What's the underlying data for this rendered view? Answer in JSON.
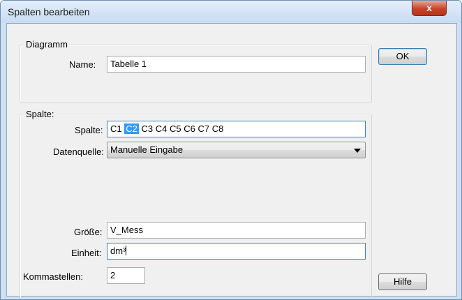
{
  "window": {
    "title": "Spalten bearbeiten",
    "close_label": "x"
  },
  "diagramm": {
    "legend": "Diagramm",
    "name_label": "Name:",
    "name_value": "Tabelle 1"
  },
  "spalte": {
    "legend": "Spalte:",
    "spalte_label": "Spalte:",
    "columns": [
      "C1",
      "C2",
      "C3",
      "C4",
      "C5",
      "C6",
      "C7",
      "C8"
    ],
    "selected_column": "C2",
    "datenquelle_label": "Datenquelle:",
    "datenquelle_value": "Manuelle Eingabe",
    "groesse_label": "Größe:",
    "groesse_value": "V_Mess",
    "einheit_label": "Einheit:",
    "einheit_value": "dm³",
    "kommastellen_label": "Kommastellen:",
    "kommastellen_value": "2"
  },
  "buttons": {
    "ok": "OK",
    "hilfe": "Hilfe"
  },
  "colors": {
    "selection": "#3399ff",
    "focus_border": "#3c7fb1",
    "close": "#c5442b"
  }
}
